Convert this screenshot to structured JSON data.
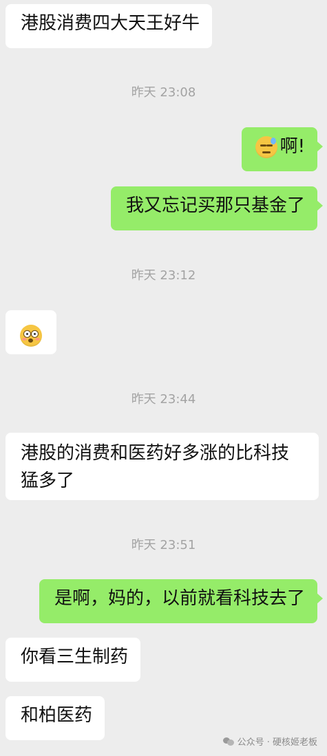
{
  "messages": [
    {
      "side": "left",
      "text": "港股消费四大天王好牛"
    },
    {
      "time": "昨天 23:08"
    },
    {
      "side": "right",
      "emoji": "sleepy-sweat-face",
      "text": "啊!"
    },
    {
      "side": "right",
      "text": "我又忘记买那只基金了"
    },
    {
      "time": "昨天 23:12"
    },
    {
      "side": "left",
      "emoji": "flushed-face"
    },
    {
      "time": "昨天 23:44"
    },
    {
      "side": "left",
      "text": "港股的消费和医药好多涨的比科技猛多了"
    },
    {
      "time": "昨天 23:51"
    },
    {
      "side": "right",
      "text": "是啊，妈的，以前就看科技去了"
    },
    {
      "side": "left",
      "text": "你看三生制药"
    },
    {
      "side": "left",
      "text": "和柏医药"
    }
  ],
  "watermark": {
    "text": "公众号 · 硬核姬老板",
    "icon": "wechat-official-account-icon"
  },
  "colors": {
    "background": "#ededed",
    "left_bubble": "#ffffff",
    "right_bubble": "#95ec69",
    "timestamp": "#a3a3a3"
  }
}
